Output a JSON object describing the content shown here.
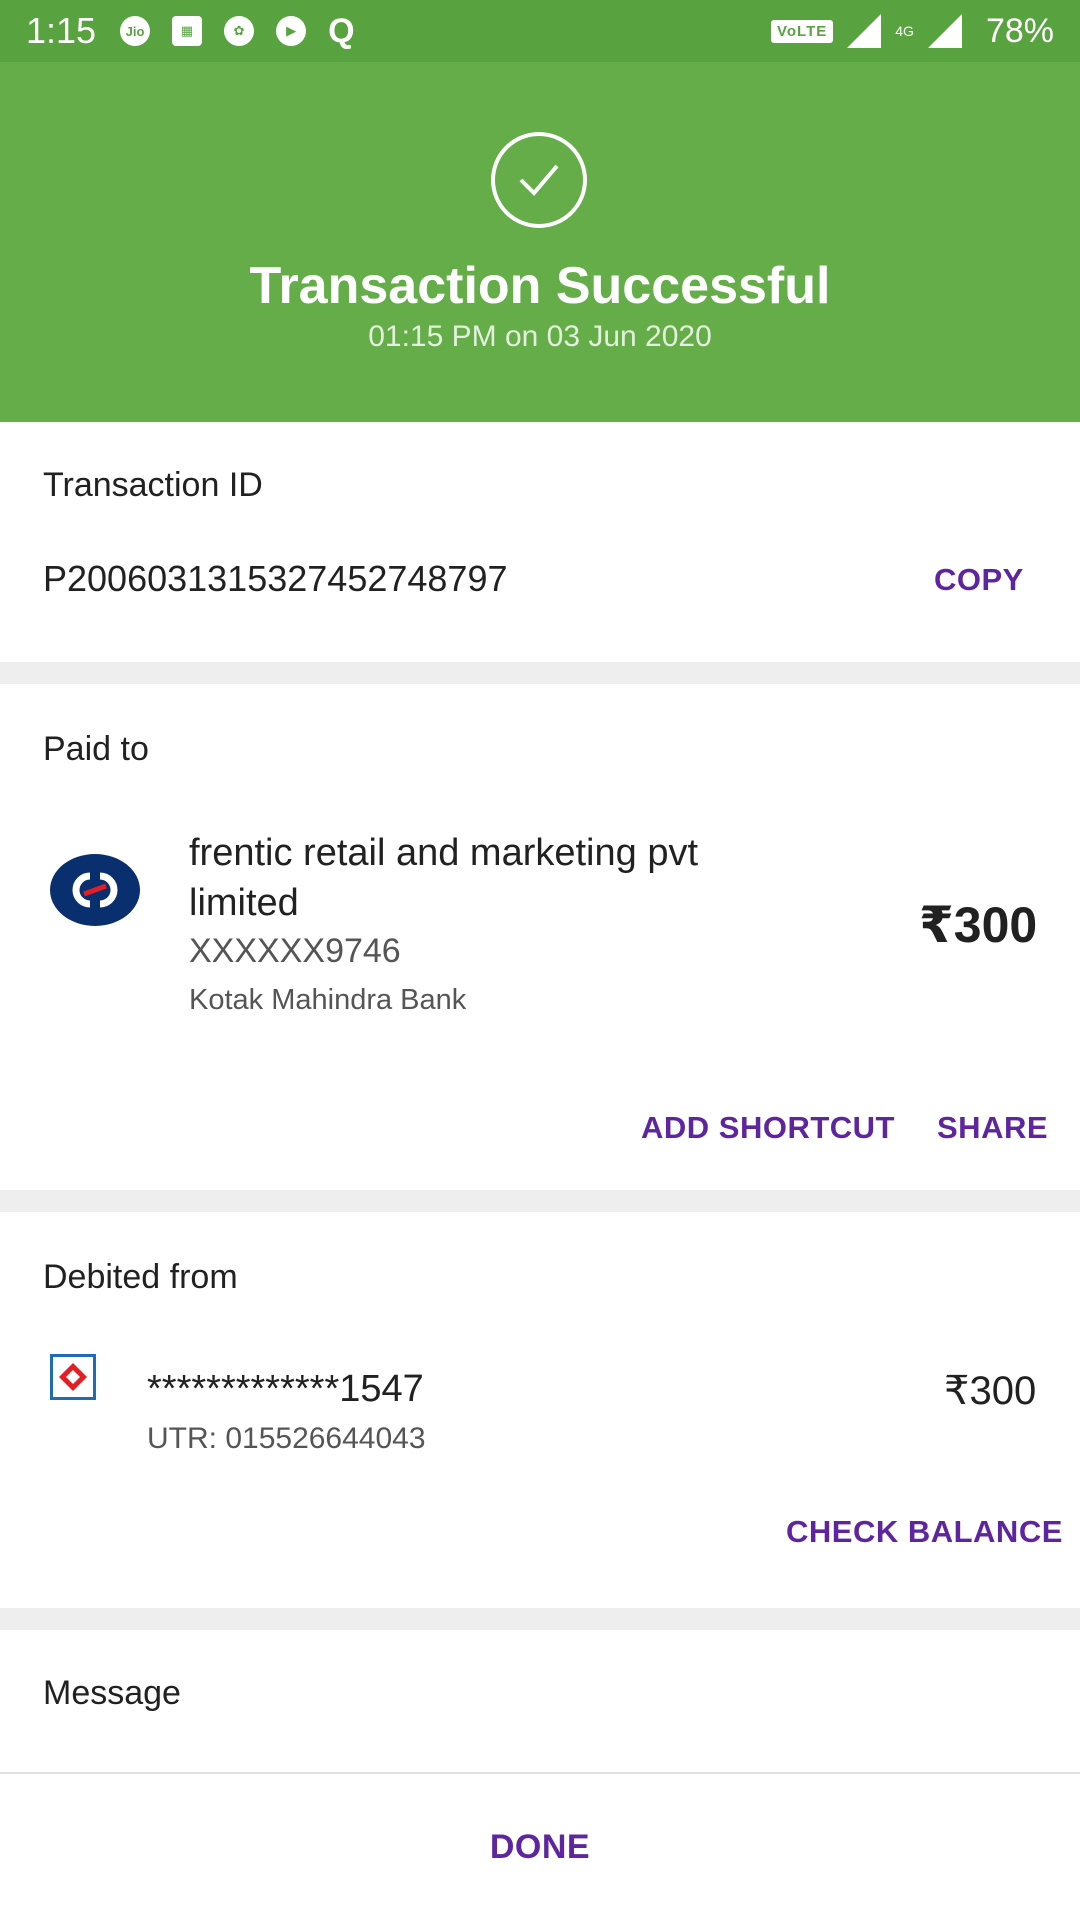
{
  "status_bar": {
    "time": "1:15",
    "network": "VoLTE",
    "network_type": "4G",
    "battery": "78%"
  },
  "header": {
    "title": "Transaction Successful",
    "datetime": "01:15 PM on 03 Jun 2020",
    "bg_color": "#64ad48"
  },
  "transaction": {
    "title": "Transaction ID",
    "id": "P2006031315327452748797",
    "copy_label": "COPY"
  },
  "paid_to": {
    "title": "Paid to",
    "name_line1": "frentic retail and marketing pvt",
    "name_line2": "limited",
    "account": "XXXXXX9746",
    "bank": "Kotak Mahindra Bank",
    "amount": "₹300",
    "add_shortcut_label": "ADD SHORTCUT",
    "share_label": "SHARE"
  },
  "debited_from": {
    "title": "Debited from",
    "account": "*************1547",
    "utr": "UTR: 015526644043",
    "amount": "₹300",
    "check_balance_label": "CHECK BALANCE"
  },
  "message": {
    "title": "Message"
  },
  "footer": {
    "done_label": "DONE"
  },
  "colors": {
    "accent": "#5f259f",
    "success": "#64ad48"
  }
}
